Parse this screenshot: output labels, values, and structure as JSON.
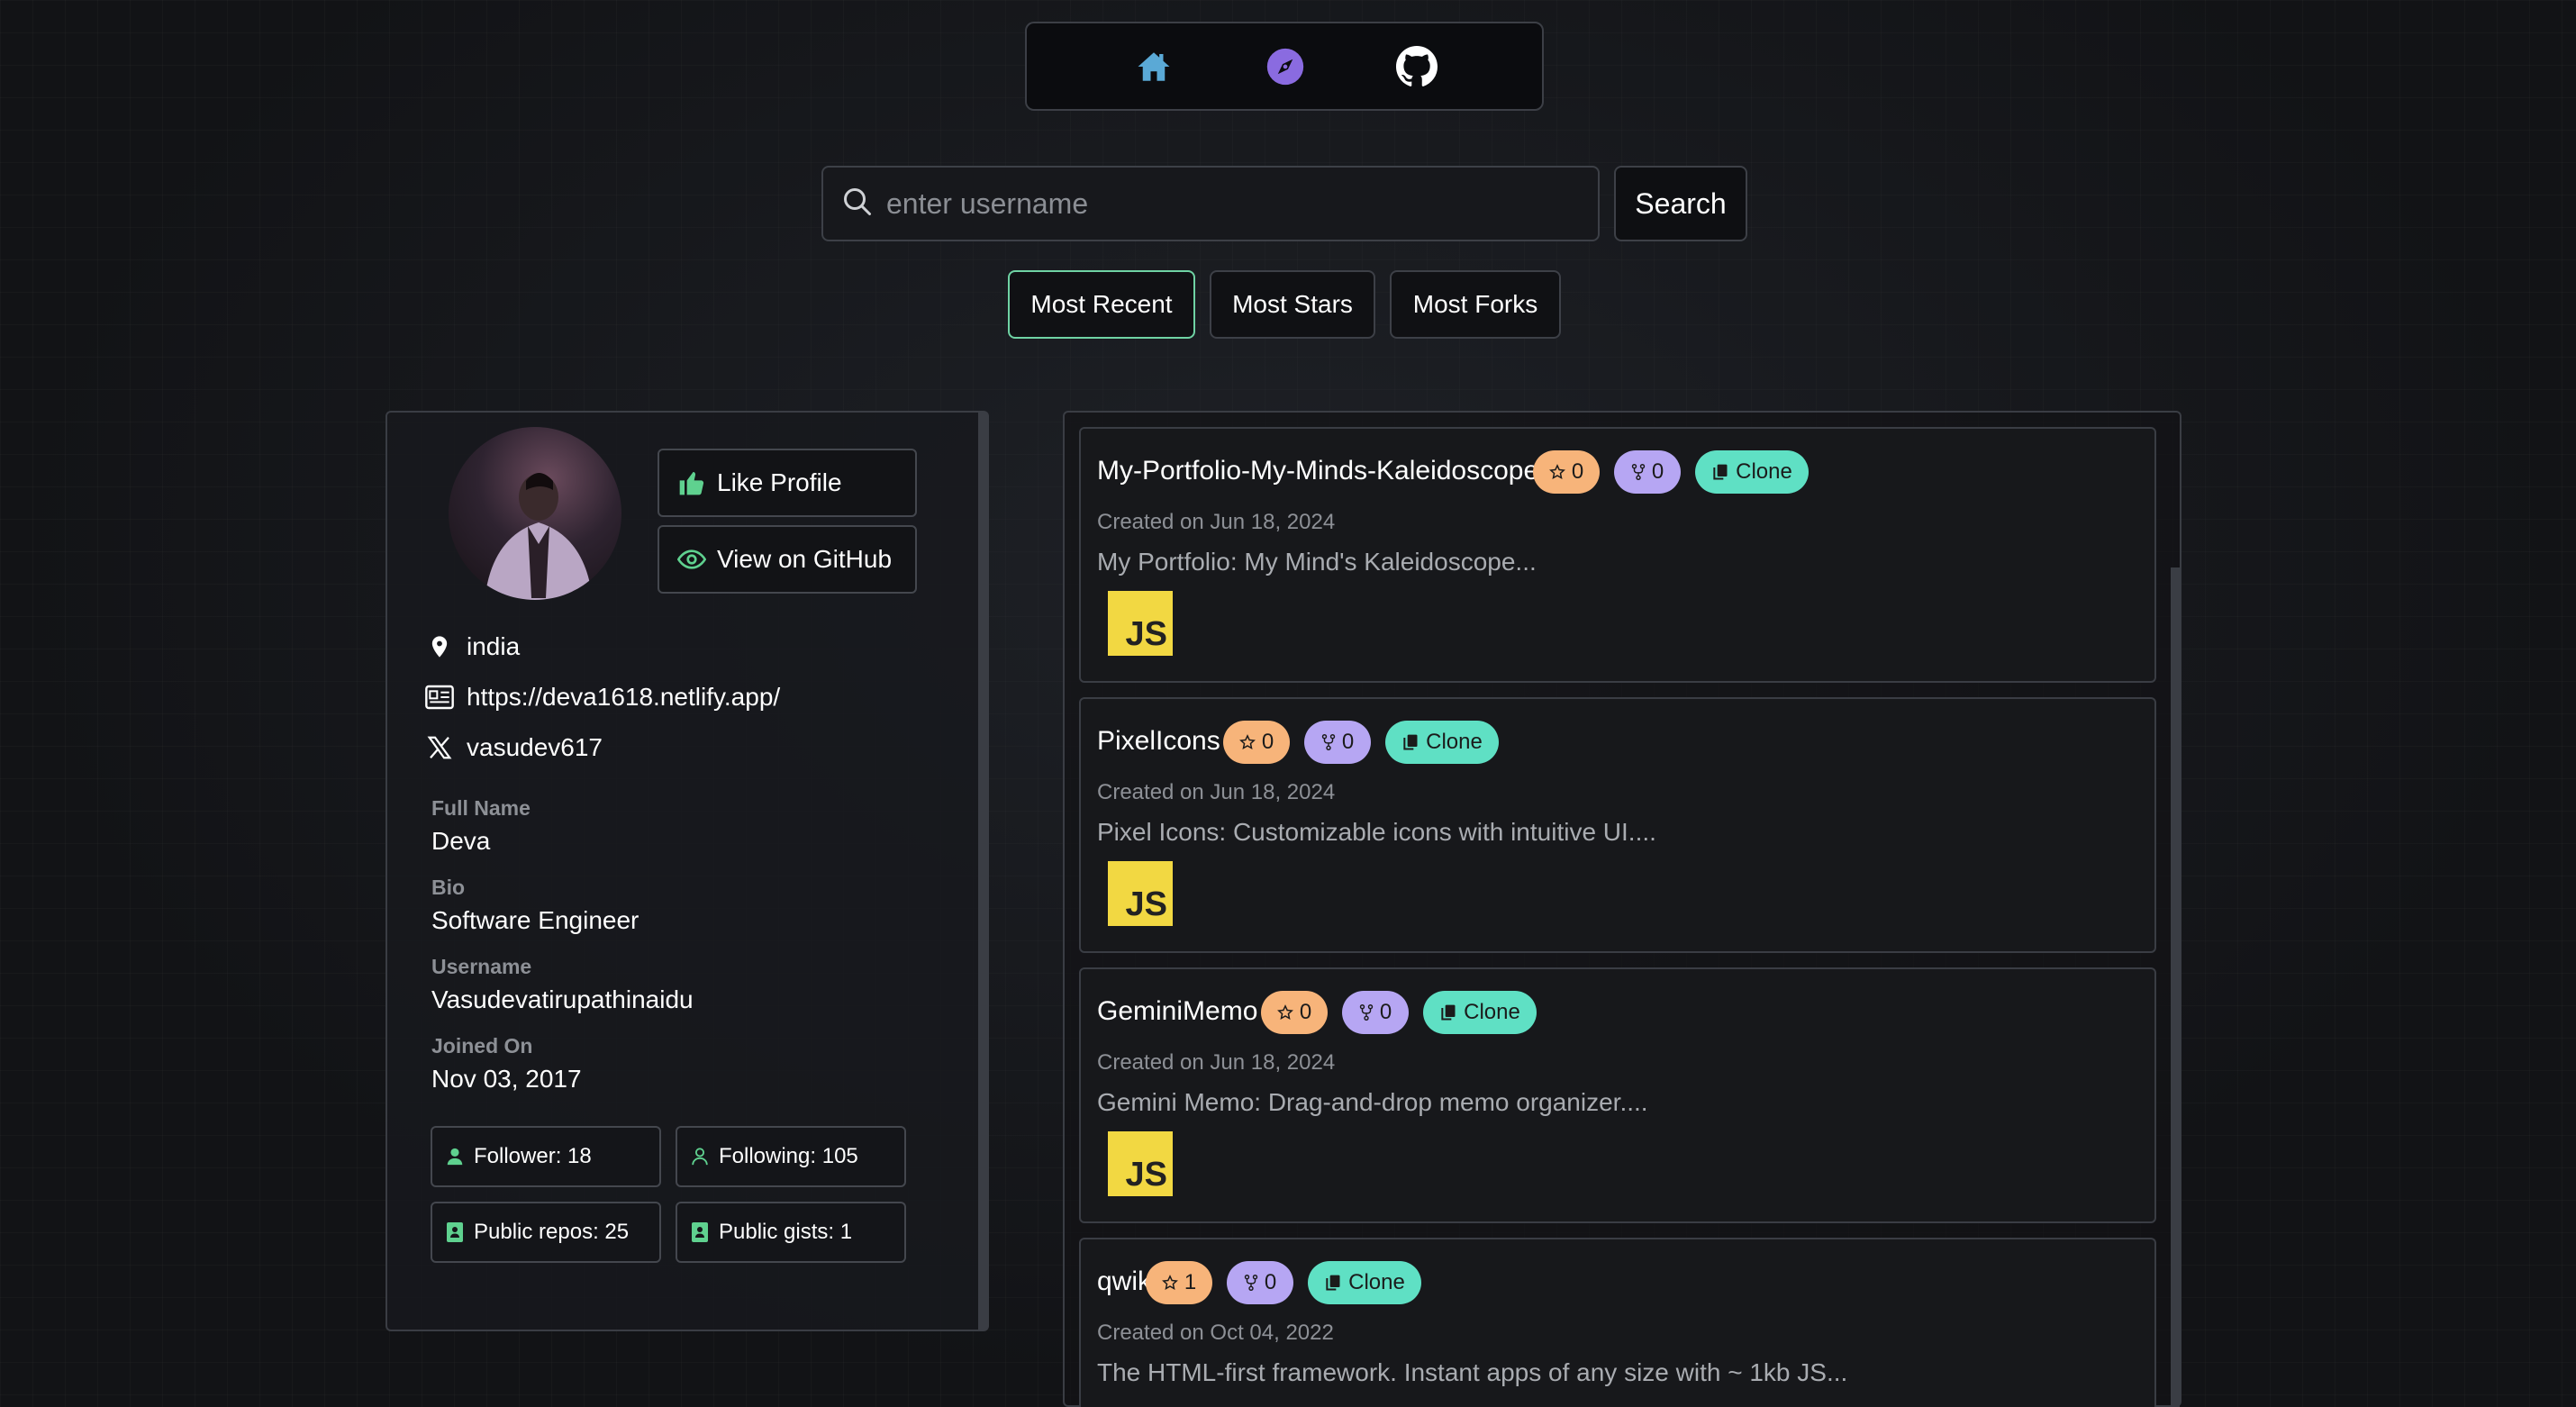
{
  "nav": {
    "icons": [
      "home-icon",
      "compass-icon",
      "github-icon"
    ],
    "colors": {
      "home": "#5aa9d6",
      "compass": "#8a6be0",
      "github": "#ffffff"
    }
  },
  "search": {
    "placeholder": "enter username",
    "value": "",
    "button_label": "Search"
  },
  "sort": {
    "options": [
      "Most Recent",
      "Most Stars",
      "Most Forks"
    ],
    "active": "Most Recent"
  },
  "profile": {
    "like_label": "Like Profile",
    "github_label": "View on GitHub",
    "location": "india",
    "website": "https://deva1618.netlify.app/",
    "twitter": "vasudev617",
    "fields": [
      {
        "label": "Full Name",
        "value": "Deva"
      },
      {
        "label": "Bio",
        "value": "Software Engineer"
      },
      {
        "label": "Username",
        "value": "Vasudevatirupathinaidu"
      },
      {
        "label": "Joined On",
        "value": "Nov 03, 2017"
      }
    ],
    "stats": {
      "followers": "Follower: 18",
      "following": "Following: 105",
      "public_repos": "Public repos: 25",
      "public_gists": "Public gists: 1"
    }
  },
  "repos": [
    {
      "name": "My-Portfolio-My-Minds-Kaleidoscope",
      "stars": "0",
      "forks": "0",
      "clone_label": "Clone",
      "created": "Created on Jun 18, 2024",
      "description": "My Portfolio: My Mind's Kaleidoscope...",
      "language": "JS"
    },
    {
      "name": "PixelIcons",
      "stars": "0",
      "forks": "0",
      "clone_label": "Clone",
      "created": "Created on Jun 18, 2024",
      "description": "Pixel Icons: Customizable icons with intuitive UI....",
      "language": "JS"
    },
    {
      "name": "GeminiMemo",
      "stars": "0",
      "forks": "0",
      "clone_label": "Clone",
      "created": "Created on Jun 18, 2024",
      "description": "Gemini Memo: Drag-and-drop memo organizer....",
      "language": "JS"
    },
    {
      "name": "qwik",
      "stars": "1",
      "forks": "0",
      "clone_label": "Clone",
      "created": "Created on Oct 04, 2022",
      "description": "The HTML-first framework. Instant apps of any size with ~ 1kb JS...",
      "language": ""
    }
  ],
  "colors": {
    "accent_green": "#6fd3a4",
    "star_badge": "#f7b47a",
    "fork_badge": "#b6a6f3",
    "clone_badge": "#5fe0c4",
    "js_badge": "#f2d842"
  }
}
